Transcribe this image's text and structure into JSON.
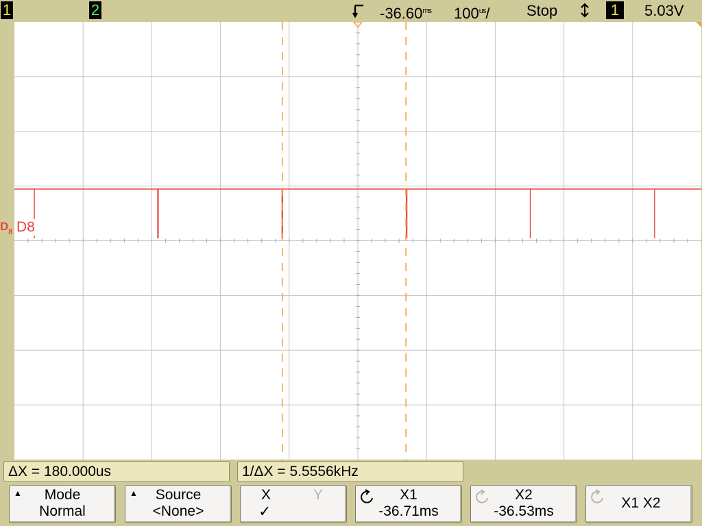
{
  "status_bar": {
    "ch1_label": "1",
    "ch2_label": "2",
    "delay": "-36.60",
    "delay_unit": "ms",
    "timebase": "100",
    "timebase_unit": "us",
    "timebase_suffix": "/",
    "run_state": "Stop",
    "trigger_source": "1",
    "trigger_level": "5.03V"
  },
  "colors": {
    "ch1": "#f2e94b",
    "ch2": "#5ef05e",
    "digital": "#e8443e",
    "cursor": "#f5a040",
    "background": "#cfca9a"
  },
  "trace": {
    "channel_marker": "D",
    "channel_marker_sub": "8",
    "label": "D8",
    "horizontal_divisions": 10,
    "vertical_divisions": 8,
    "pulses": [
      {
        "t_div": 0.29,
        "heavy": false
      },
      {
        "t_div": 2.09,
        "heavy": true
      },
      {
        "t_div": 3.9,
        "heavy": true
      },
      {
        "t_div": 5.71,
        "heavy": true
      },
      {
        "t_div": 7.51,
        "heavy": false
      },
      {
        "t_div": 9.32,
        "heavy": false
      }
    ],
    "cursors_div": [
      3.9,
      5.7
    ]
  },
  "measurements": {
    "delta_x": "ΔX = 180.000us",
    "inv_delta_x": "1/ΔX = 5.5556kHz"
  },
  "softkeys": {
    "mode": {
      "title": "Mode",
      "value": "Normal"
    },
    "source": {
      "title": "Source",
      "value": "<None>"
    },
    "xy": {
      "x": "X",
      "y": "Y",
      "check": "✓"
    },
    "x1": {
      "title": "X1",
      "value": "-36.71ms"
    },
    "x2": {
      "title": "X2",
      "value": "-36.53ms"
    },
    "x1x2": {
      "title": "X1 X2"
    }
  }
}
